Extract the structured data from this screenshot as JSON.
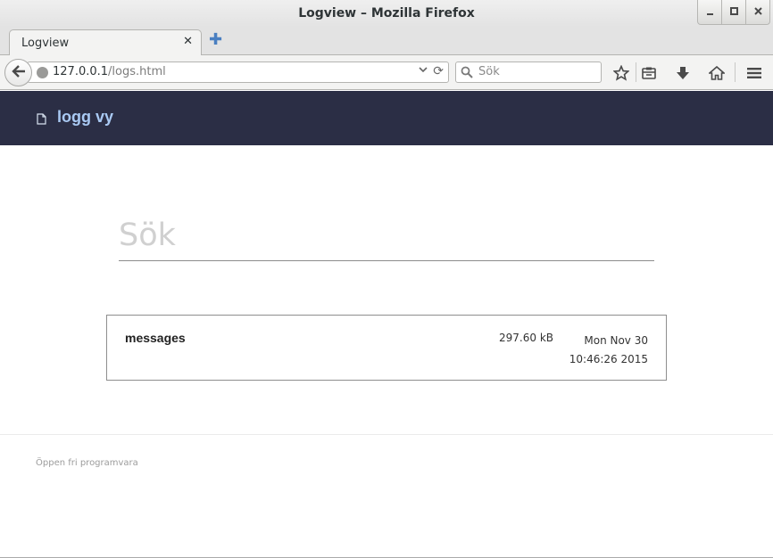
{
  "window": {
    "title": "Logview – Mozilla Firefox"
  },
  "tabs": [
    {
      "label": "Logview"
    }
  ],
  "urlbar": {
    "host": "127.0.0.1",
    "path": "/logs.html"
  },
  "search_bar": {
    "placeholder": "Sök"
  },
  "app": {
    "title": "logg vy"
  },
  "page_search": {
    "placeholder": "Sök"
  },
  "logs": [
    {
      "name": "messages",
      "size": "297.60 kB",
      "date_line1": "Mon Nov 30",
      "date_line2": "10:46:26 2015"
    }
  ],
  "footer": {
    "text": "Öppen fri programvara"
  },
  "colors": {
    "header_bg": "#2b2e45",
    "header_title": "#a9c9f3"
  },
  "icons": [
    "minimize-icon",
    "maximize-icon",
    "close-icon",
    "tab-close-icon",
    "new-tab-icon",
    "back-arrow-icon",
    "site-identity-icon",
    "dropdown-arrow-icon",
    "reload-icon",
    "search-icon",
    "bookmark-star-icon",
    "reading-list-icon",
    "download-icon",
    "home-icon",
    "menu-icon",
    "document-icon"
  ]
}
